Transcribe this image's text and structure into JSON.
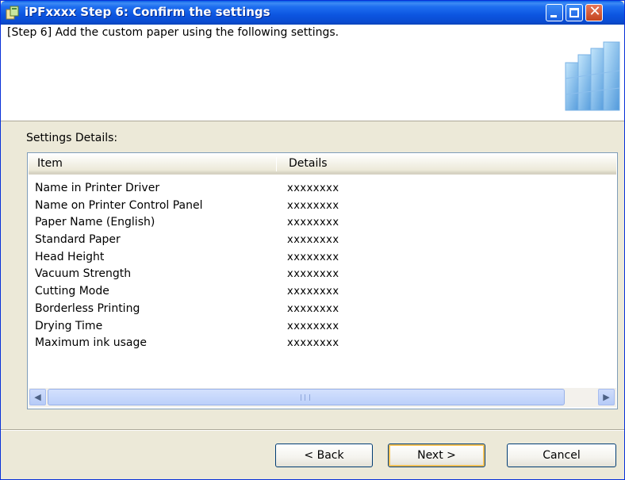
{
  "window": {
    "title": "iPFxxxx  Step 6: Confirm the settings"
  },
  "header": {
    "instruction": "[Step 6] Add the custom paper using the following settings."
  },
  "settings": {
    "label": "Settings Details:",
    "columns": [
      "Item",
      "Details"
    ],
    "rows": [
      {
        "item": "Name in Printer Driver",
        "details": "xxxxxxxx"
      },
      {
        "item": "Name on Printer Control Panel",
        "details": "xxxxxxxx"
      },
      {
        "item": "Paper Name (English)",
        "details": "xxxxxxxx"
      },
      {
        "item": "Standard Paper",
        "details": "xxxxxxxx"
      },
      {
        "item": "Head Height",
        "details": "xxxxxxxx"
      },
      {
        "item": "Vacuum Strength",
        "details": "xxxxxxxx"
      },
      {
        "item": "Cutting Mode",
        "details": "xxxxxxxx"
      },
      {
        "item": "Borderless Printing",
        "details": "xxxxxxxx"
      },
      {
        "item": "Drying Time",
        "details": "xxxxxxxx"
      },
      {
        "item": "Maximum ink usage",
        "details": "xxxxxxxx"
      }
    ]
  },
  "buttons": {
    "back": "< Back",
    "next": "Next >",
    "cancel": "Cancel"
  },
  "icons": {
    "app": "printer-paper-icon",
    "minimize": "minimize-icon",
    "maximize": "maximize-icon",
    "close": "close-icon",
    "header_art": "paper-rolls-icon",
    "scroll_left": "chevron-left-icon",
    "scroll_right": "chevron-right-icon"
  },
  "colors": {
    "titlebar": "#0a4bd0",
    "dialog_bg": "#ece9d8",
    "close_button": "#c3441f",
    "default_button_highlight": "#f6c258"
  }
}
